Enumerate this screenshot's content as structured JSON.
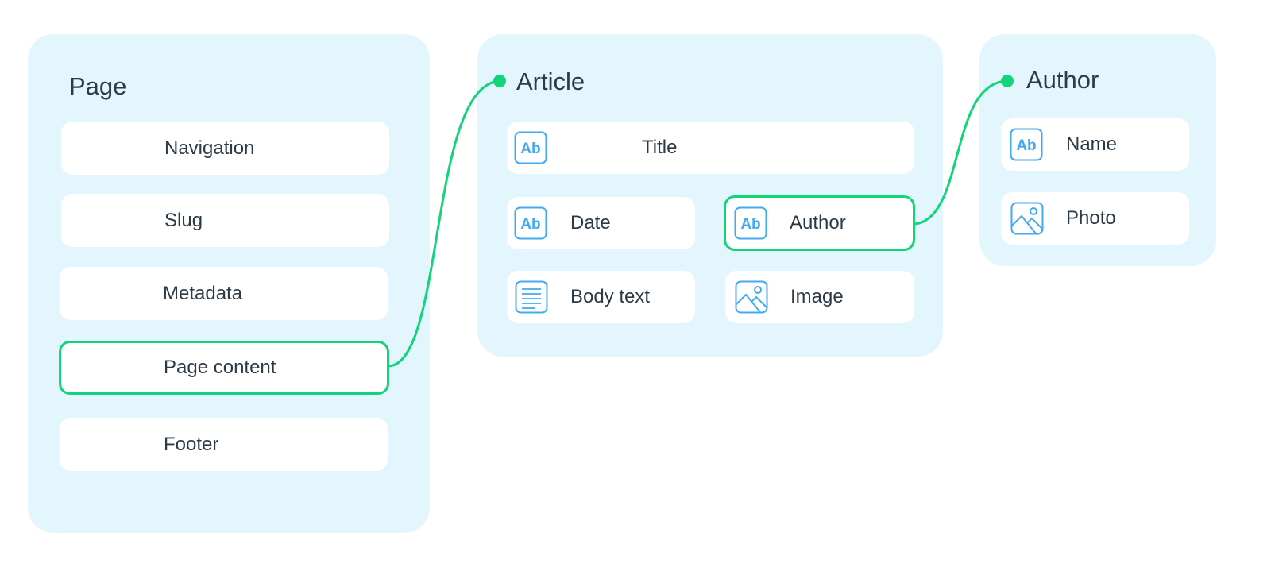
{
  "accent_color": "#12d47a",
  "icon_color": "#42aaf0",
  "panels": {
    "page": {
      "title": "Page",
      "fields": [
        {
          "label": "Navigation"
        },
        {
          "label": "Slug"
        },
        {
          "label": "Metadata"
        },
        {
          "label": "Page content",
          "linked_to": "article"
        },
        {
          "label": "Footer"
        }
      ]
    },
    "article": {
      "title": "Article",
      "fields": [
        {
          "label": "Title",
          "icon": "text-icon"
        },
        {
          "label": "Date",
          "icon": "text-icon"
        },
        {
          "label": "Author",
          "icon": "text-icon",
          "linked_to": "author"
        },
        {
          "label": "Body text",
          "icon": "rich-text-icon"
        },
        {
          "label": "Image",
          "icon": "image-icon"
        }
      ]
    },
    "author": {
      "title": "Author",
      "fields": [
        {
          "label": "Name",
          "icon": "text-icon"
        },
        {
          "label": "Photo",
          "icon": "image-icon"
        }
      ]
    }
  },
  "icon_text": "Ab"
}
